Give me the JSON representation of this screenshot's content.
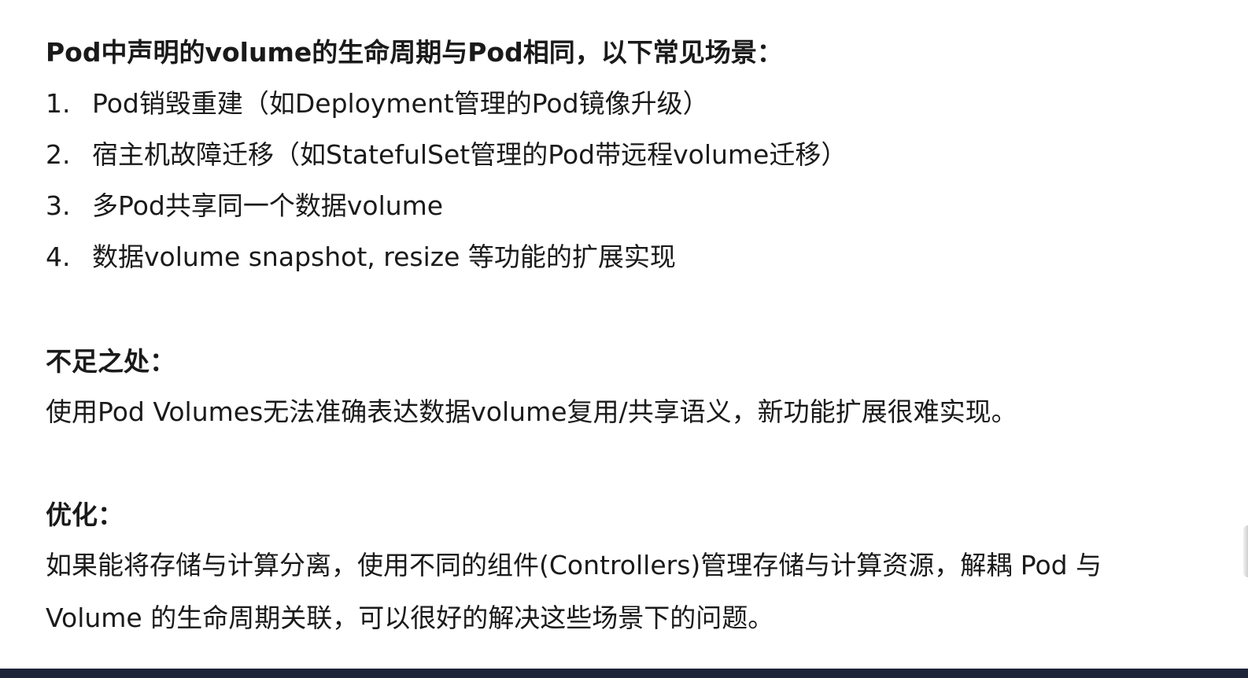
{
  "intro": "Pod中声明的volume的生命周期与Pod相同，以下常见场景：",
  "scenarios": [
    {
      "num": "1.",
      "text": "Pod销毁重建（如Deployment管理的Pod镜像升级）"
    },
    {
      "num": "2.",
      "text": "宿主机故障迁移（如StatefulSet管理的Pod带远程volume迁移）"
    },
    {
      "num": "3.",
      "text": "多Pod共享同一个数据volume"
    },
    {
      "num": "4.",
      "text": "数据volume snapshot, resize 等功能的扩展实现"
    }
  ],
  "shortcomings": {
    "heading": "不足之处：",
    "body": "使用Pod Volumes无法准确表达数据volume复用/共享语义，新功能扩展很难实现。"
  },
  "optimization": {
    "heading": "优化：",
    "body_line1": "如果能将存储与计算分离，使用不同的组件(Controllers)管理存储与计算资源，解耦 Pod 与",
    "body_line2": "Volume 的生命周期关联，可以很好的解决这些场景下的问题。"
  },
  "colors": {
    "text": "#1a1a1a",
    "bottom_bar": "#1f2538",
    "background": "#ffffff"
  }
}
